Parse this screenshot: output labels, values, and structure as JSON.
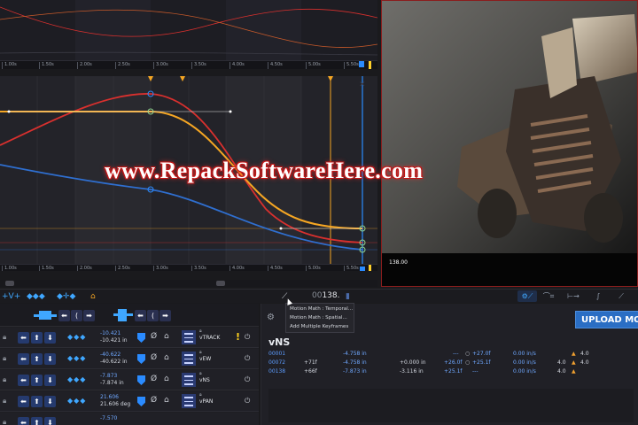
{
  "timeline": {
    "ruler_ticks": [
      "1.00s",
      "1.50s",
      "2.00s",
      "2.50s",
      "3.00s",
      "3.50s",
      "4.00s",
      "4.50s",
      "5.00s",
      "5.50s"
    ]
  },
  "watermark": "www.RepackSoftwareHere.com",
  "video": {
    "timecode": "138.00"
  },
  "toolbar": {
    "frame_prefix": "00",
    "frame_value": "138",
    "frame_suffix": "."
  },
  "context_menu": {
    "items": [
      "Motion Math : Temporal...",
      "Motion Math : Spatial...",
      "Add Multiple Keyframes"
    ]
  },
  "tracks": [
    {
      "value_a": "-10.421",
      "value_b": "-10.421 in",
      "name": "vTRACK",
      "warning": true
    },
    {
      "value_a": "-40.622",
      "value_b": "-40.622 in",
      "name": "vEW",
      "warning": false
    },
    {
      "value_a": "-7.873",
      "value_b": "-7.874 in",
      "name": "vNS",
      "warning": false
    },
    {
      "value_a": "21.606",
      "value_b": "21.606 deg",
      "name": "vPAN",
      "warning": false
    },
    {
      "value_a": "-7.570",
      "value_b": "",
      "name": "",
      "warning": false
    }
  ],
  "data_panel": {
    "upload_label": "UPLOAD MO",
    "title": "vNS",
    "rows": [
      {
        "id": "00001",
        "c1": "",
        "c2": "-4.758 in",
        "c3": "",
        "c4": "---",
        "c5": "+27.0f",
        "c6": "0.00 in/s",
        "c7": "",
        "c8": "4.0"
      },
      {
        "id": "00072",
        "c1": "+71f",
        "c2": "-4.758 in",
        "c3": "+0.000 in",
        "c4": "+26.0f",
        "c5": "+25.1f",
        "c6": "0.00 in/s",
        "c7": "4.0",
        "c8": "4.0"
      },
      {
        "id": "00138",
        "c1": "+66f",
        "c2": "-7.873 in",
        "c3": "-3.116 in",
        "c4": "+25.1f",
        "c5": "---",
        "c6": "0.00 in/s",
        "c7": "4.0",
        "c8": ""
      }
    ]
  },
  "colors": {
    "accent_blue": "#2a8bff",
    "curve_orange": "#f5a623",
    "curve_red": "#d9302e",
    "curve_blue": "#2f6fd0",
    "upload_button": "#2a6ec4",
    "warning": "#ffd21f"
  },
  "icons": {
    "toolbar_left": [
      "plus-v-icon",
      "diamond-nav-icon",
      "crosshair-nav-icon",
      "home-icon"
    ],
    "toolbar_right": [
      "gear-curve-icon",
      "curve-edit-icon",
      "insert-key-icon",
      "ease-icon",
      "linear-icon"
    ]
  }
}
